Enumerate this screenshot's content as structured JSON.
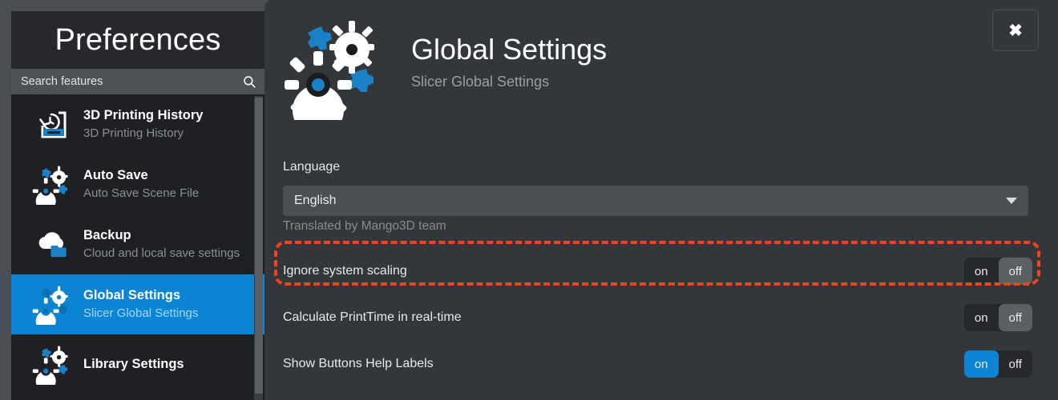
{
  "window": {
    "close_label": "✖"
  },
  "sidebar": {
    "title": "Preferences",
    "search": {
      "placeholder": "Search features",
      "value": "",
      "icon": "search-icon"
    },
    "items": [
      {
        "label": "3D Printing History",
        "sub": "3D Printing History",
        "icon": "print-history-icon",
        "selected": false
      },
      {
        "label": "Auto Save",
        "sub": "Auto Save Scene File",
        "icon": "gears-icon",
        "selected": false
      },
      {
        "label": "Backup",
        "sub": "Cloud and local save settings",
        "icon": "cloud-folder-icon",
        "selected": false
      },
      {
        "label": "Global Settings",
        "sub": "Slicer Global Settings",
        "icon": "gears-icon",
        "selected": true
      },
      {
        "label": "Library Settings",
        "sub": "",
        "icon": "gears-icon",
        "selected": false
      }
    ]
  },
  "panel": {
    "header": {
      "icon": "gears-icon",
      "title": "Global Settings",
      "subtitle": "Slicer Global Settings"
    },
    "language": {
      "label": "Language",
      "selected": "English",
      "hint": "Translated by Mango3D team"
    },
    "rows": [
      {
        "label": "Ignore system scaling",
        "on_label": "on",
        "off_label": "off",
        "state": "off",
        "highlighted": true
      },
      {
        "label": "Calculate PrintTime in real-time",
        "on_label": "on",
        "off_label": "off",
        "state": "off",
        "highlighted": false
      },
      {
        "label": "Show Buttons Help Labels",
        "on_label": "on",
        "off_label": "off",
        "state": "on",
        "highlighted": false
      }
    ]
  },
  "colors": {
    "accent": "#0b84d4",
    "panel_bg": "#33363a",
    "sidebar_bg": "#1f2023",
    "highlight_outline": "#f4411e",
    "toggle_off_bg": "#5c6065"
  }
}
